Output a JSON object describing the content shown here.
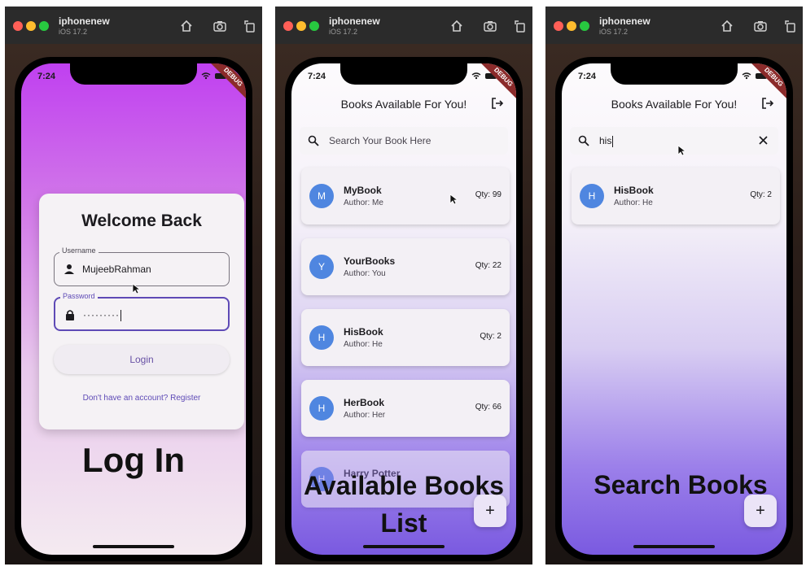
{
  "simulator": {
    "device_name": "iphonenew",
    "os_version": "iOS 17.2"
  },
  "status_bar": {
    "time": "7:24",
    "debug_banner": "DEBUG"
  },
  "login": {
    "title": "Welcome Back",
    "username_label": "Username",
    "username_value": "MujeebRahman",
    "password_label": "Password",
    "password_value": "·········",
    "login_button": "Login",
    "register_link": "Don't have an account? Register",
    "caption": "Log In"
  },
  "books_screen": {
    "appbar_title": "Books Available For You!",
    "search_placeholder": "Search Your Book Here",
    "books": [
      {
        "initial": "M",
        "title": "MyBook",
        "author": "Author: Me",
        "qty": "Qty: 99"
      },
      {
        "initial": "Y",
        "title": "YourBooks",
        "author": "Author: You",
        "qty": "Qty: 22"
      },
      {
        "initial": "H",
        "title": "HisBook",
        "author": "Author: He",
        "qty": "Qty: 2"
      },
      {
        "initial": "H",
        "title": "HerBook",
        "author": "Author: Her",
        "qty": "Qty: 66"
      },
      {
        "initial": "H",
        "title": "Harry Potter",
        "author": "",
        "qty": ""
      }
    ],
    "fab_label": "+",
    "caption_line1": "Available Books",
    "caption_line2": "List"
  },
  "search_screen": {
    "appbar_title": "Books Available For You!",
    "search_query": "his",
    "results": [
      {
        "initial": "H",
        "title": "HisBook",
        "author": "Author: He",
        "qty": "Qty: 2"
      }
    ],
    "fab_label": "+",
    "caption": "Search Books"
  },
  "colors": {
    "accent": "#6750a4",
    "avatar": "#4f86e0",
    "login_gradient_top": "#c040f0",
    "list_gradient_bottom": "#7a5ae0"
  },
  "icons": [
    "home-icon",
    "screenshot-icon",
    "rotate-icon",
    "person-icon",
    "lock-icon",
    "search-icon",
    "logout-icon",
    "close-icon",
    "add-icon"
  ]
}
